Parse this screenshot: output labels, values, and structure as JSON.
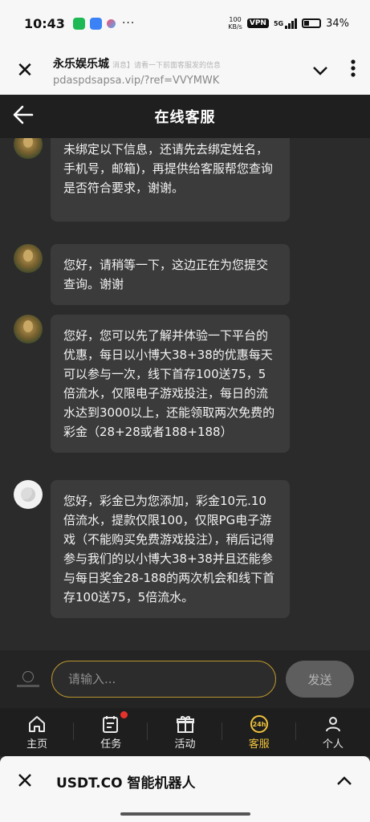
{
  "status_bar": {
    "time": "10:43",
    "net_speed_value": "100",
    "net_speed_unit": "KB/s",
    "vpn": "VPN",
    "network": "5G",
    "battery": "34%"
  },
  "browser": {
    "title": "永乐娱乐城",
    "subtitle": "消息】请看一下前面客服发的信息",
    "url": "pdaspdsapsa.vip/?ref=VVYMWK"
  },
  "chat": {
    "title": "在线客服",
    "messages": [
      {
        "avatar": "mona-lisa-avatar",
        "text": "您好，还请您先提供一个游戏帐号，(如未绑定以下信息，还请先去绑定姓名，手机号，邮箱)，再提供给客服帮您查询是否符合要求，谢谢。"
      },
      {
        "avatar": "mona-lisa-avatar",
        "text": "您好，请稍等一下，这边正在为您提交查询。谢谢"
      },
      {
        "avatar": "mona-lisa-avatar",
        "text": "您好，您可以先了解并体验一下平台的优惠，每日以小博大38+38的优惠每天可以参与一次，线下首存100送75，5倍流水，仅限电子游戏投注，每日的流水达到3000以上，还能领取两次免费的彩金（28+28或者188+188）"
      },
      {
        "avatar": "moon-avatar",
        "text": "您好，彩金已为您添加，彩金10元.10倍流水，提款仅限100，仅限PG电子游戏（不能购买免费游戏投注），稍后记得参与我们的以小博大38+38并且还能参与每日奖金28-188的两次机会和线下首存100送75，5倍流水。"
      }
    ],
    "input_placeholder": "请输入...",
    "send_label": "发送"
  },
  "nav": {
    "items": [
      {
        "label": "主页",
        "icon": "home-icon"
      },
      {
        "label": "任务",
        "icon": "task-icon"
      },
      {
        "label": "活动",
        "icon": "gift-icon"
      },
      {
        "label": "客服",
        "icon": "support-24h-icon",
        "active": true
      },
      {
        "label": "个人",
        "icon": "profile-icon"
      }
    ],
    "badge_color": "#e5322d",
    "active_color": "#f0c33c"
  },
  "bottom_sheet": {
    "title": "USDT.CO 智能机器人"
  },
  "colors": {
    "chat_bg": "#2b2b2b",
    "bubble_bg": "#3b3b3b",
    "input_border": "#b8952e"
  }
}
